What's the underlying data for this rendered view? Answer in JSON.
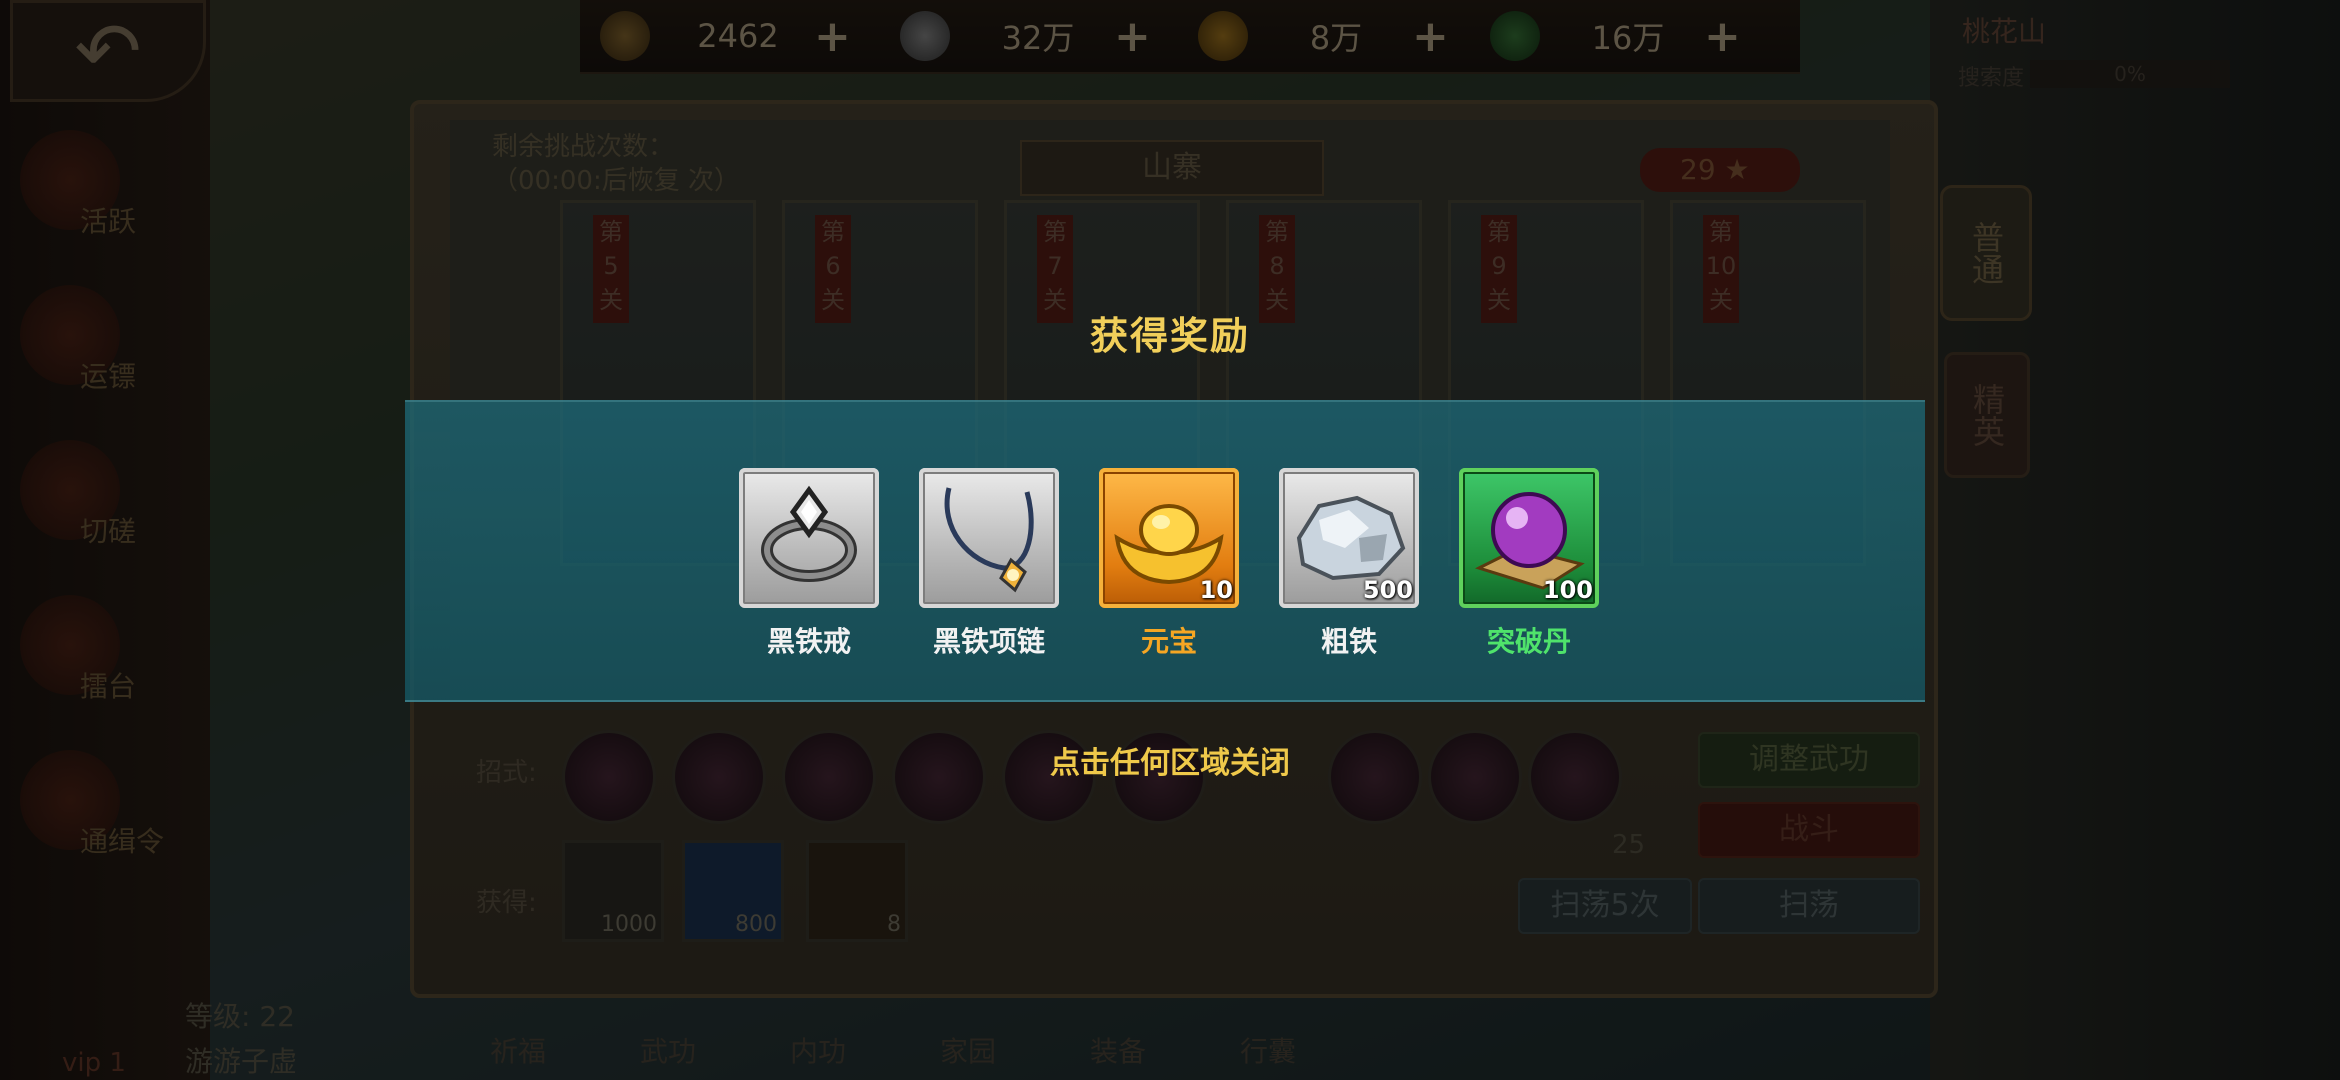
{
  "top_bar": {
    "currencies": [
      {
        "icon": "ingot-icon",
        "value": "2462",
        "plus": "+"
      },
      {
        "icon": "silver-icon",
        "value": "32万",
        "plus": "+"
      },
      {
        "icon": "coin-icon",
        "value": "8万",
        "plus": "+"
      },
      {
        "icon": "jade-icon",
        "value": "16万",
        "plus": "+"
      }
    ],
    "location": "桃花山",
    "search_label": "搜索度",
    "search_value": "0%"
  },
  "back_button": "↶",
  "sidebar": {
    "items": [
      {
        "label": "活跃",
        "icon": "chest-icon"
      },
      {
        "label": "运镖",
        "icon": "cart-icon"
      },
      {
        "label": "切磋",
        "icon": "swords-icon"
      },
      {
        "label": "擂台",
        "icon": "drum-icon"
      },
      {
        "label": "通缉令",
        "icon": "wanted-icon"
      }
    ]
  },
  "panel": {
    "title": "山寨",
    "remain_line1": "剩余挑战次数：",
    "remain_line2_prefix": "（",
    "remain_time": "00:00:",
    "remain_line2_suffix": "后恢复 次）",
    "stars": "29 ★",
    "stages": [
      "第5关",
      "第6关",
      "第7关",
      "第8关",
      "第9关",
      "第10关"
    ],
    "skills_label": "招式:",
    "gain_label": "获得:",
    "loot": [
      {
        "icon": "silver-ingot-icon",
        "count": "1000"
      },
      {
        "icon": "exp-orb-icon",
        "count": "800"
      },
      {
        "icon": "ore-icon",
        "count": "8"
      }
    ],
    "stamina": "25",
    "buttons": {
      "adjust": "调整武功",
      "fight": "战斗",
      "sweep5": "扫荡5次",
      "sweep": "扫荡"
    }
  },
  "tabs": {
    "normal": "普通",
    "elite": "精英"
  },
  "player": {
    "level": "等级: 22",
    "name": "游游子虚",
    "vip": "vip 1"
  },
  "bottom_nav": [
    "祈福",
    "武功",
    "内功",
    "家园",
    "装备",
    "行囊"
  ],
  "reward_modal": {
    "title": "获得奖励",
    "close_hint": "点击任何区域关闭",
    "items": [
      {
        "name": "黑铁戒",
        "count": "",
        "rarity": "silver",
        "name_color": "#f2f2f2",
        "icon": "ring-icon"
      },
      {
        "name": "黑铁项链",
        "count": "",
        "rarity": "silver",
        "name_color": "#f2f2f2",
        "icon": "necklace-icon"
      },
      {
        "name": "元宝",
        "count": "10",
        "rarity": "gold",
        "name_color": "#f5a623",
        "icon": "gold-ingot-icon"
      },
      {
        "name": "粗铁",
        "count": "500",
        "rarity": "silver",
        "name_color": "#f2f2f2",
        "icon": "iron-ore-icon"
      },
      {
        "name": "突破丹",
        "count": "100",
        "rarity": "green",
        "name_color": "#4fe36b",
        "icon": "purple-pill-icon"
      }
    ]
  }
}
